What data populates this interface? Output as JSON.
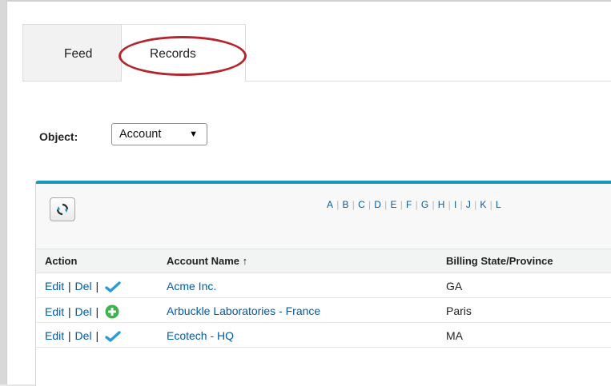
{
  "tabs": [
    {
      "label": "Feed",
      "active": false
    },
    {
      "label": "Records",
      "active": true
    }
  ],
  "object_filter": {
    "label": "Object:",
    "selected": "Account",
    "caret": "▼"
  },
  "list": {
    "alphabet": [
      "A",
      "B",
      "C",
      "D",
      "E",
      "F",
      "G",
      "H",
      "I",
      "J",
      "K",
      "L"
    ],
    "accent_color": "#1797c0",
    "link_color": "#015ba7",
    "annotation_color": "#b3262d",
    "columns": [
      {
        "label": "Action"
      },
      {
        "label": "Account Name ↑"
      },
      {
        "label": "Billing State/Province"
      }
    ],
    "rows": [
      {
        "edit": "Edit",
        "del": "Del",
        "sep": "|",
        "status_icon": "check-icon",
        "name": "Acme Inc.",
        "state": "GA"
      },
      {
        "edit": "Edit",
        "del": "Del",
        "sep": "|",
        "status_icon": "plus-circle-icon",
        "name": "Arbuckle Laboratories - France",
        "state": "Paris"
      },
      {
        "edit": "Edit",
        "del": "Del",
        "sep": "|",
        "status_icon": "check-icon",
        "name": "Ecotech - HQ",
        "state": "MA"
      }
    ]
  }
}
